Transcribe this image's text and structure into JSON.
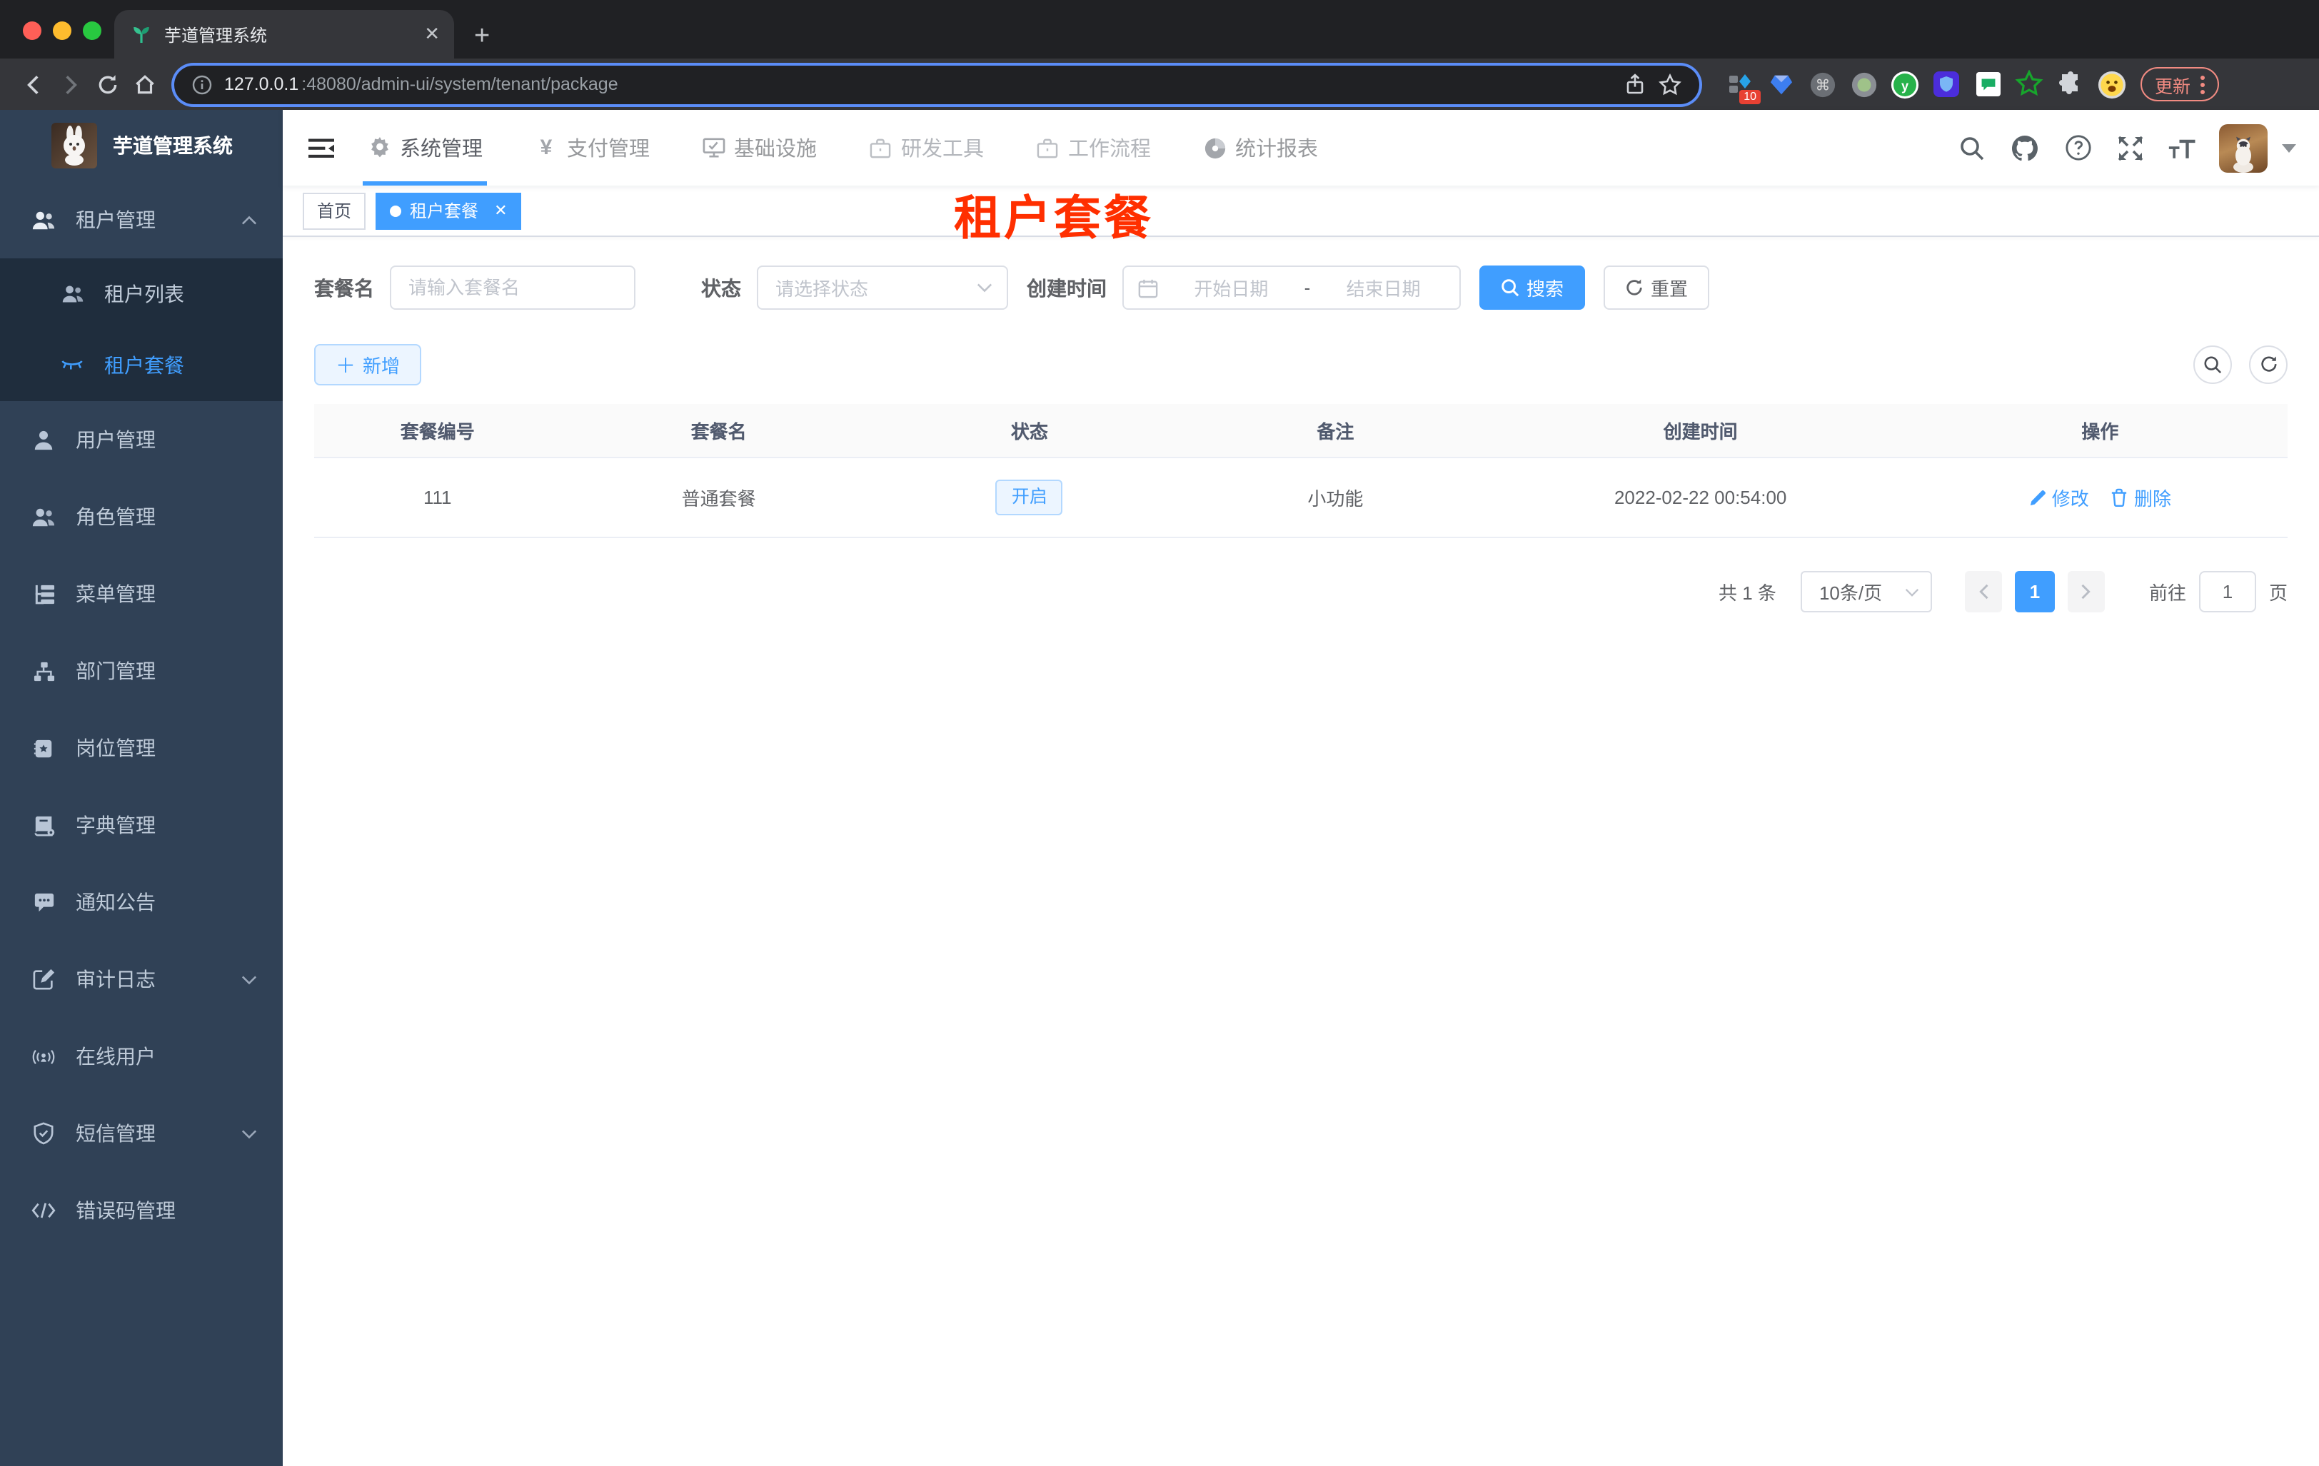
{
  "colors": {
    "accent": "#409eff",
    "sidebar_bg": "#304156",
    "submenu_bg": "#1f2d3d",
    "annotation_red": "#ff2f00",
    "tag_bg": "#ecf5ff",
    "tag_border": "#b3d8ff"
  },
  "browser": {
    "tab_title": "芋道管理系统",
    "url_host": "127.0.0.1",
    "url_rest": ":48080/admin-ui/system/tenant/package",
    "extension_badge": "10",
    "update_label": "更新"
  },
  "sidebar": {
    "logo_title": "芋道管理系统",
    "parent": {
      "label": "租户管理"
    },
    "sub": [
      {
        "label": "租户列表"
      },
      {
        "label": "租户套餐"
      }
    ],
    "items": [
      {
        "label": "用户管理"
      },
      {
        "label": "角色管理"
      },
      {
        "label": "菜单管理"
      },
      {
        "label": "部门管理"
      },
      {
        "label": "岗位管理"
      },
      {
        "label": "字典管理"
      },
      {
        "label": "通知公告"
      },
      {
        "label": "审计日志"
      },
      {
        "label": "在线用户"
      },
      {
        "label": "短信管理"
      },
      {
        "label": "错误码管理"
      }
    ]
  },
  "topnav": {
    "items": [
      {
        "label": "系统管理"
      },
      {
        "label": "支付管理"
      },
      {
        "label": "基础设施"
      },
      {
        "label": "研发工具"
      },
      {
        "label": "工作流程"
      },
      {
        "label": "统计报表"
      }
    ]
  },
  "tags": {
    "home": "首页",
    "active": "租户套餐"
  },
  "annotation": {
    "text": "租户套餐"
  },
  "filters": {
    "name_label": "套餐名",
    "name_placeholder": "请输入套餐名",
    "status_label": "状态",
    "status_placeholder": "请选择状态",
    "date_label": "创建时间",
    "date_start": "开始日期",
    "date_separator": "-",
    "date_end": "结束日期",
    "search_label": "搜索",
    "reset_label": "重置"
  },
  "toolbar": {
    "add_label": "新增"
  },
  "table": {
    "columns": [
      "套餐编号",
      "套餐名",
      "状态",
      "备注",
      "创建时间",
      "操作"
    ],
    "rows": [
      {
        "id": "111",
        "name": "普通套餐",
        "status": "开启",
        "remark": "小功能",
        "created": "2022-02-22 00:54:00",
        "edit": "修改",
        "delete": "删除"
      }
    ]
  },
  "pagination": {
    "total": "共 1 条",
    "page_size": "10条/页",
    "current_page": "1",
    "goto_label": "前往",
    "goto_value": "1",
    "page_unit": "页"
  }
}
